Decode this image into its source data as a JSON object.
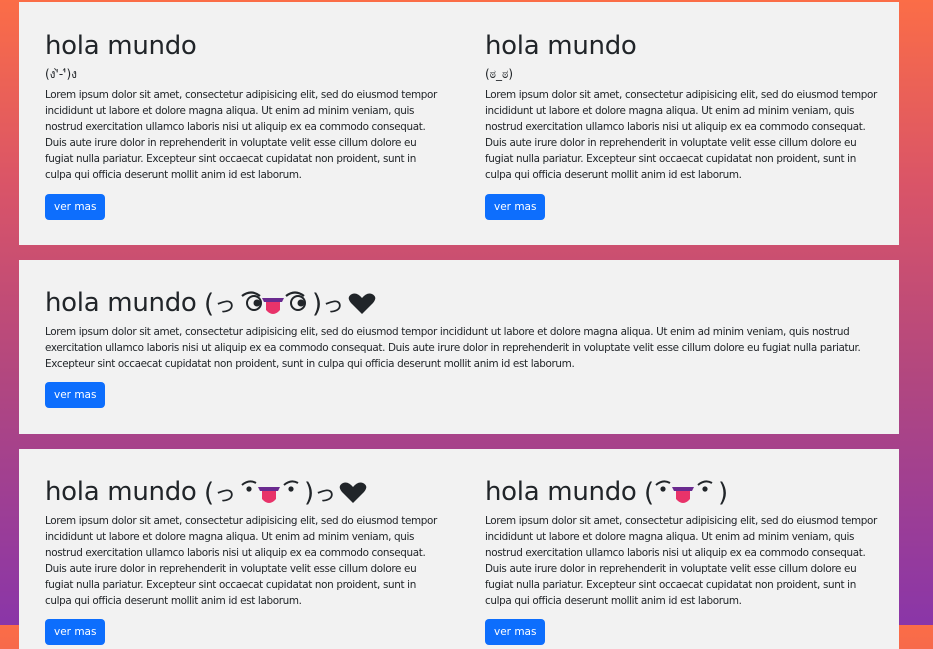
{
  "cards": [
    {
      "left": {
        "title": "hola mundo",
        "face": "(ง'̀-'́)ง",
        "body": "Lorem ipsum dolor sit amet, consectetur adipisicing elit, sed do eiusmod tempor incididunt ut labore et dolore magna aliqua. Ut enim ad minim veniam, quis nostrud exercitation ullamco laboris nisi ut aliquip ex ea commodo consequat. Duis aute irure dolor in reprehenderit in voluptate velit esse cillum dolore eu fugiat nulla pariatur. Excepteur sint occaecat cupidatat non proident, sunt in culpa qui officia deserunt mollit anim id est laborum.",
        "button": "ver mas"
      },
      "right": {
        "title": "hola mundo",
        "face": "(ಠ_ಠ)",
        "body": "Lorem ipsum dolor sit amet, consectetur adipisicing elit, sed do eiusmod tempor incididunt ut labore et dolore magna aliqua. Ut enim ad minim veniam, quis nostrud exercitation ullamco laboris nisi ut aliquip ex ea commodo consequat. Duis aute irure dolor in reprehenderit in voluptate velit esse cillum dolore eu fugiat nulla pariatur. Excepteur sint occaecat cupidatat non proident, sunt in culpa qui officia deserunt mollit anim id est laborum.",
        "button": "ver mas"
      }
    },
    {
      "full": {
        "title": "hola mundo",
        "face_icon": "kaomoji-hug-tongue-heart",
        "body": "Lorem ipsum dolor sit amet, consectetur adipisicing elit, sed do eiusmod tempor incididunt ut labore et dolore magna aliqua. Ut enim ad minim veniam, quis nostrud exercitation ullamco laboris nisi ut aliquip ex ea commodo consequat. Duis aute irure dolor in reprehenderit in voluptate velit esse cillum dolore eu fugiat nulla pariatur. Excepteur sint occaecat cupidatat non proident, sunt in culpa qui officia deserunt mollit anim id est laborum.",
        "button": "ver mas"
      }
    },
    {
      "left": {
        "title": "hola mundo",
        "face_icon": "kaomoji-lenny-tongue-heart",
        "body": "Lorem ipsum dolor sit amet, consectetur adipisicing elit, sed do eiusmod tempor incididunt ut labore et dolore magna aliqua. Ut enim ad minim veniam, quis nostrud exercitation ullamco laboris nisi ut aliquip ex ea commodo consequat. Duis aute irure dolor in reprehenderit in voluptate velit esse cillum dolore eu fugiat nulla pariatur. Excepteur sint occaecat cupidatat non proident, sunt in culpa qui officia deserunt mollit anim id est laborum.",
        "button": "ver mas"
      },
      "right": {
        "title": "hola mundo",
        "face_icon": "kaomoji-lenny-tongue",
        "body": "Lorem ipsum dolor sit amet, consectetur adipisicing elit, sed do eiusmod tempor incididunt ut labore et dolore magna aliqua. Ut enim ad minim veniam, quis nostrud exercitation ullamco laboris nisi ut aliquip ex ea commodo consequat. Duis aute irure dolor in reprehenderit in voluptate velit esse cillum dolore eu fugiat nulla pariatur. Excepteur sint occaecat cupidatat non proident, sunt in culpa qui officia deserunt mollit anim id est laborum.",
        "button": "ver mas"
      }
    }
  ],
  "colors": {
    "card_bg": "#f2f2f2",
    "button_bg": "#0d6efd",
    "gradient_top": "#fb6d47",
    "gradient_bottom": "#8a36a8"
  }
}
